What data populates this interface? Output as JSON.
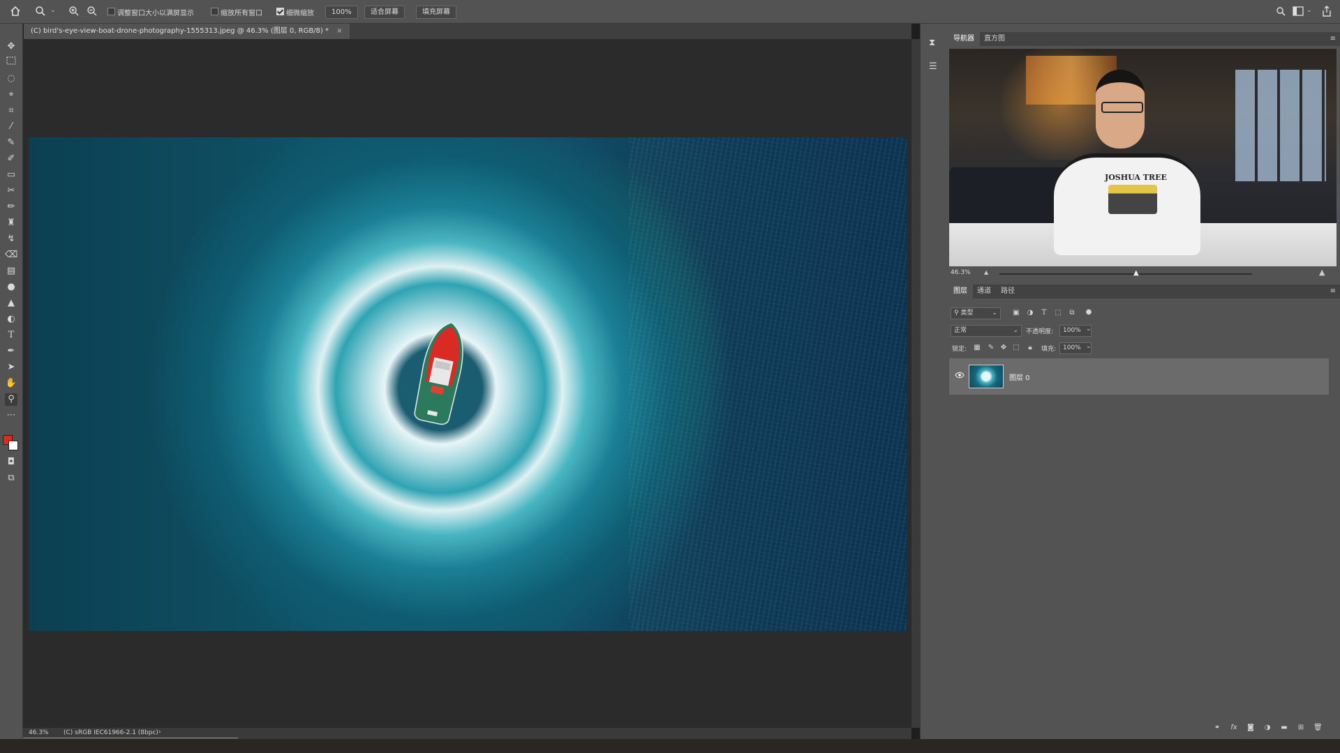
{
  "options_bar": {
    "resize_windows_label": "调整窗口大小以满屏显示",
    "zoom_all_windows_label": "缩放所有窗口",
    "scrubby_zoom_label": "细微缩放",
    "zoom_value": "100%",
    "fit_screen_label": "适合屏幕",
    "fill_screen_label": "填充屏幕",
    "scrubby_zoom_checked": true
  },
  "document_tab": {
    "title": "(C) bird's-eye-view-boat-drone-photography-1555313.jpeg @ 46.3% (图层 0, RGB/8) *",
    "close": "×"
  },
  "status_bar": {
    "zoom": "46.3%",
    "profile": "(C) sRGB IEC61966-2.1 (8bpc)",
    "arrow": "›"
  },
  "navigator": {
    "tabs": [
      "导航器",
      "直方图"
    ],
    "zoom": "46.3%",
    "preview_text": "JOSHUA TREE"
  },
  "layers_panel": {
    "tabs": [
      "图层",
      "通道",
      "路径"
    ],
    "filter_kind": "类型",
    "blend_mode": "正常",
    "opacity_label": "不透明度:",
    "opacity_value": "100%",
    "lock_label": "锁定:",
    "fill_label": "填充:",
    "fill_value": "100%",
    "layers": [
      {
        "name": "图层 0",
        "visible": true
      }
    ]
  },
  "colors": {
    "foreground": "#e02a1b",
    "background": "#ffffff",
    "panel": "#535353",
    "canvas": "#2b2b2b"
  }
}
